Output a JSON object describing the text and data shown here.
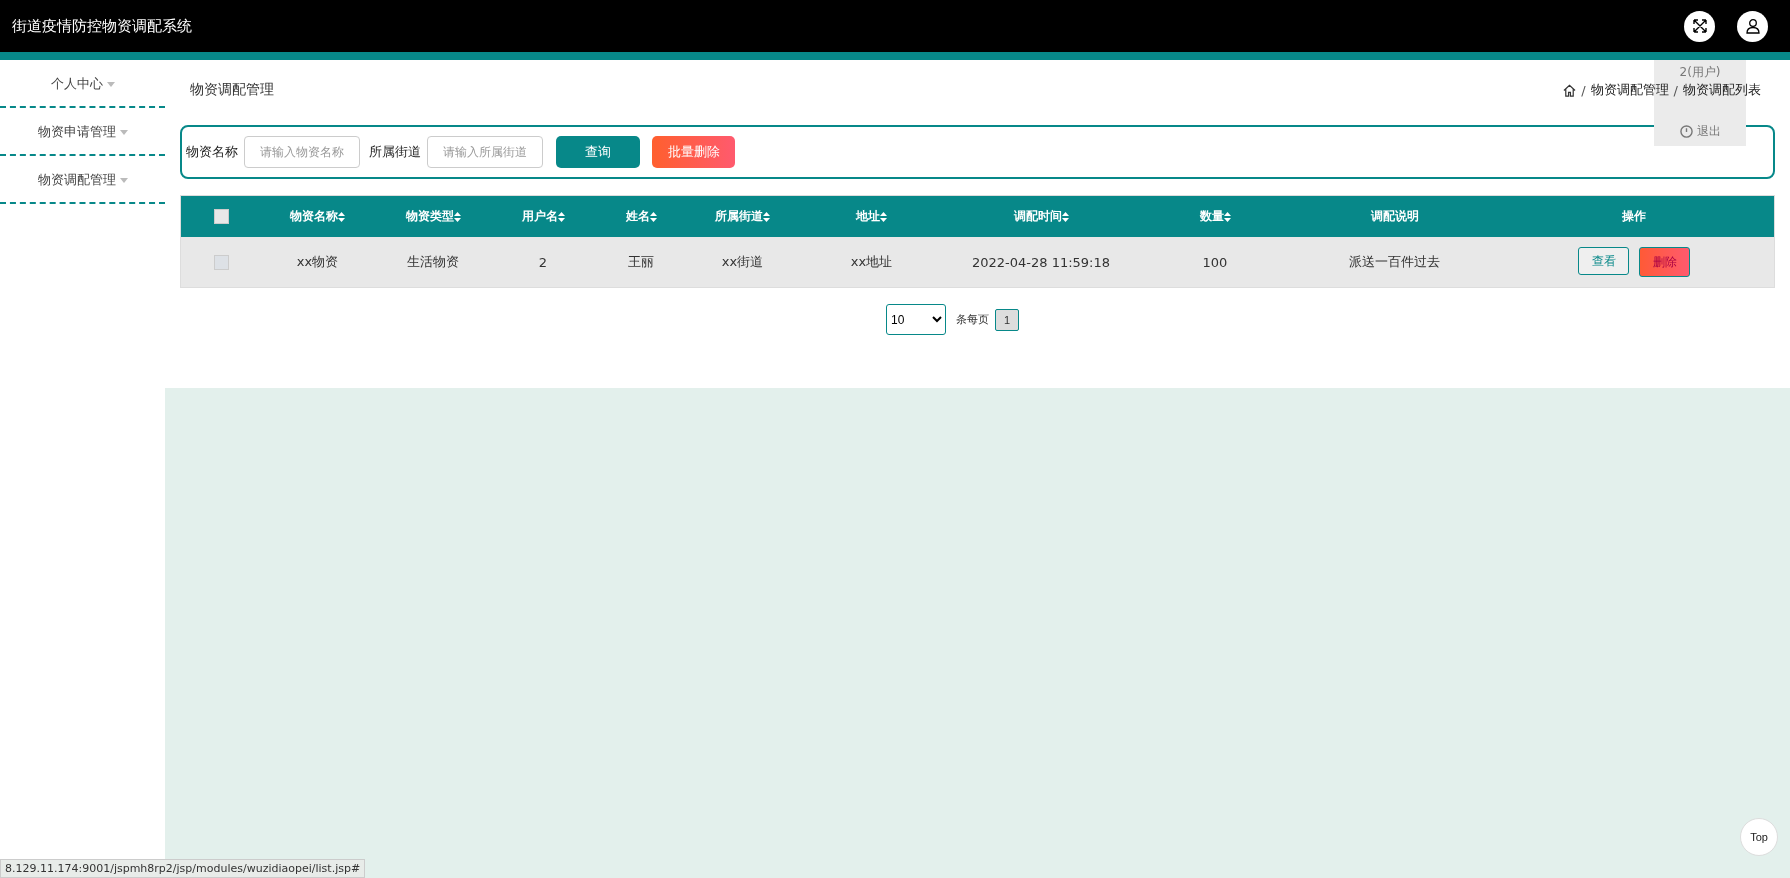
{
  "header": {
    "title": "街道疫情防控物资调配系统"
  },
  "user_menu": {
    "items": [
      {
        "kind": "user",
        "label": "2(用户)"
      },
      {
        "kind": "logout",
        "label": "退出"
      }
    ]
  },
  "sidebar": {
    "items": [
      {
        "label": "个人中心"
      },
      {
        "label": "物资申请管理"
      },
      {
        "label": "物资调配管理"
      }
    ]
  },
  "page": {
    "title": "物资调配管理",
    "breadcrumb_separator": "/",
    "breadcrumb": [
      "物资调配管理",
      "物资调配列表"
    ]
  },
  "search": {
    "fields": [
      {
        "label": "物资名称",
        "placeholder": "请输入物资名称"
      },
      {
        "label": "所属街道",
        "placeholder": "请输入所属街道"
      }
    ],
    "query_button": "查询",
    "batch_delete_button": "批量删除"
  },
  "table": {
    "all_checked": false,
    "columns": [
      {
        "label": "物资名称",
        "sortable": true
      },
      {
        "label": "物资类型",
        "sortable": true
      },
      {
        "label": "用户名",
        "sortable": true
      },
      {
        "label": "姓名",
        "sortable": true
      },
      {
        "label": "所属街道",
        "sortable": true
      },
      {
        "label": "地址",
        "sortable": true
      },
      {
        "label": "调配时间",
        "sortable": true
      },
      {
        "label": "数量",
        "sortable": true
      },
      {
        "label": "调配说明",
        "sortable": false
      },
      {
        "label": "操作",
        "sortable": false
      }
    ],
    "rows": [
      {
        "checked": false,
        "cells": [
          "xx物资",
          "生活物资",
          "2",
          "王丽",
          "xx街道",
          "xx地址",
          "2022-04-28 11:59:18",
          "100",
          "派送一百件过去"
        ],
        "view_button": "查看",
        "delete_button": "删除"
      }
    ]
  },
  "pagination": {
    "page_size": "10",
    "per_page_label": "条每页",
    "pages": [
      {
        "label": "1",
        "selected": true
      }
    ]
  },
  "top_button": "Top",
  "status_url": "8.129.11.174:9001/jspmh8rp2/jsp/modules/wuzidiaopei/list.jsp#"
}
